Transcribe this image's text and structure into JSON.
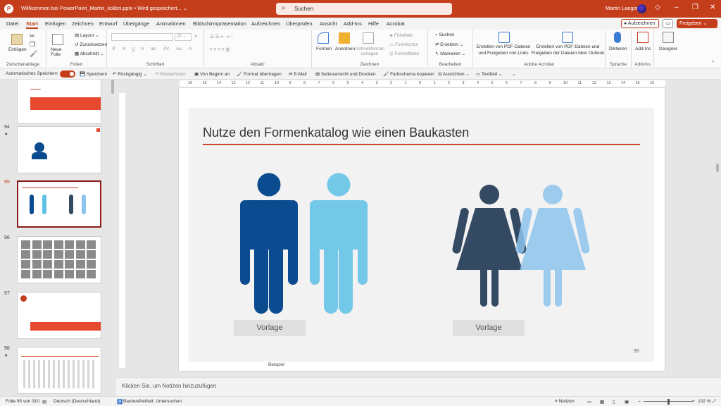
{
  "titlebar": {
    "doc_title": "Willkommen bei PowerPoint_Martin_kolibri.pptx  •  Wird gespeichert... ⌄",
    "search_placeholder": "Suchen",
    "user_name": "Martin Laeger",
    "accent_color": "#c43e1c"
  },
  "menu": {
    "tabs": [
      "Datei",
      "Start",
      "Einfügen",
      "Zeichnen",
      "Entwurf",
      "Übergänge",
      "Animationen",
      "Bildschirmpräsentation",
      "Aufzeichnen",
      "Überprüfen",
      "Ansicht",
      "Add-Ins",
      "Hilfe",
      "Acrobat"
    ],
    "active_tab": "Start",
    "record_label": "Aufzeichnen",
    "share_label": "Freigeben"
  },
  "ribbon": {
    "clipboard": {
      "paste": "Einfügen",
      "label": "Zwischenablage"
    },
    "slides": {
      "new_slide": "Neue Folie",
      "layout": "Layout",
      "reset": "Zurücksetzen",
      "section": "Abschnitt",
      "label": "Folien"
    },
    "font": {
      "label": "Schriftart"
    },
    "paragraph": {
      "label": "Absatz"
    },
    "drawing": {
      "shapes": "Formen",
      "arrange": "Anordnen",
      "quick_styles": "Schnellformat-vorlagen",
      "fill": "Fülleffekt",
      "outline": "Formkontur",
      "effects": "Formeffekte",
      "label": "Zeichnen"
    },
    "editing": {
      "find": "Suchen",
      "replace": "Ersetzen",
      "select": "Markieren",
      "label": "Bearbeiten"
    },
    "acrobat": {
      "create_share": "Erstellen von PDF-Dateien und Freigeben von Links",
      "create_outlook": "Erstellen von PDF-Dateien und Freigeben der Dateien über Outlook",
      "label": "Adobe Acrobat"
    },
    "voice": {
      "dictate": "Diktieren",
      "label": "Sprache"
    },
    "addins": {
      "addins": "Add-Ins",
      "label": "Add-Ins"
    },
    "designer": {
      "designer": "Designer"
    }
  },
  "qat": {
    "autosave": "Automatisches Speichern",
    "save": "Speichern",
    "undo": "Rückgängig",
    "redo": "Wiederholen",
    "from_start": "Von Beginn an",
    "format_painter": "Format übertragen",
    "email": "E-Mail",
    "page_view": "Seitenansicht und Drucken",
    "color_scheme": "Farbschema kopieren",
    "align": "Ausrichten",
    "textbox": "Textfeld"
  },
  "thumbnails": [
    {
      "num": "",
      "marker": ""
    },
    {
      "num": "94",
      "marker": "★"
    },
    {
      "num": "95",
      "marker": ""
    },
    {
      "num": "96",
      "marker": ""
    },
    {
      "num": "97",
      "marker": ""
    },
    {
      "num": "98",
      "marker": "★"
    }
  ],
  "ruler_ticks": [
    "16",
    "15",
    "14",
    "13",
    "12",
    "11",
    "10",
    "9",
    "8",
    "7",
    "6",
    "5",
    "4",
    "3",
    "2",
    "1",
    "0",
    "1",
    "2",
    "3",
    "4",
    "5",
    "6",
    "7",
    "8",
    "9",
    "10",
    "11",
    "12",
    "13",
    "14",
    "15",
    "16"
  ],
  "slide": {
    "title": "Nutze den Formenkatalog wie einen Baukasten",
    "vorlage_left": "Vorlage",
    "vorlage_right": "Vorlage",
    "page_number": "95",
    "footer": "Beispiel",
    "colors": {
      "male_dark": "#0b4b8f",
      "male_light": "#5fc1e6",
      "female_dark": "#344a63",
      "female_light": "#8ec5ee",
      "title_line": "#d2442a"
    }
  },
  "notes": {
    "placeholder": "Klicken Sie, um Notizen hinzuzufügen"
  },
  "statusbar": {
    "slide_info": "Folie 95 von 310",
    "language": "Deutsch (Deutschland)",
    "accessibility": "Barrierefreiheit: Untersuchen",
    "notes": "Notizen",
    "zoom": "102 %"
  }
}
